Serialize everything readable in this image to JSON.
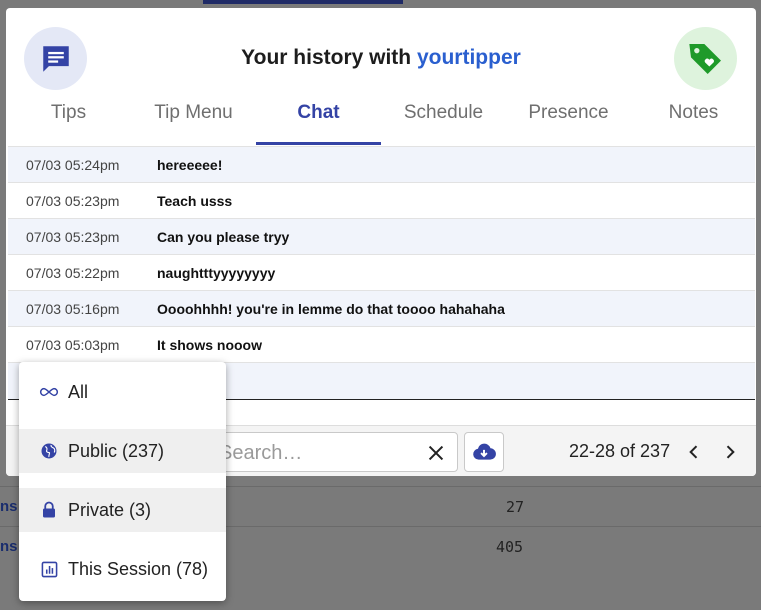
{
  "background": {
    "rows": [
      {
        "left": "ns",
        "value": "27"
      },
      {
        "left": "ns",
        "value": "405"
      }
    ]
  },
  "modal": {
    "title_prefix": "Your history with ",
    "username": "yourtipper",
    "tabs": [
      {
        "label": "Tips"
      },
      {
        "label": "Tip Menu"
      },
      {
        "label": "Chat",
        "active": true
      },
      {
        "label": "Schedule"
      },
      {
        "label": "Presence"
      },
      {
        "label": "Notes"
      }
    ],
    "messages": [
      {
        "time": "07/03 05:24pm",
        "text": "hereeeee!"
      },
      {
        "time": "07/03 05:23pm",
        "text": "Teach usss"
      },
      {
        "time": "07/03 05:23pm",
        "text": "Can you please tryy"
      },
      {
        "time": "07/03 05:22pm",
        "text": "naughtttyyyyyyyy"
      },
      {
        "time": "07/03 05:16pm",
        "text": "Oooohhhh! you're in lemme do that toooo hahahaha"
      },
      {
        "time": "07/03 05:03pm",
        "text": "It shows nooow"
      }
    ],
    "footer": {
      "search_placeholder": "Search…",
      "pagination": "22-28 of 237"
    }
  },
  "filter_menu": {
    "items": [
      {
        "icon": "infinity-icon",
        "label": "All"
      },
      {
        "icon": "globe-icon",
        "label": "Public (237)"
      },
      {
        "icon": "lock-icon",
        "label": "Private (3)"
      },
      {
        "icon": "bar-chart-icon",
        "label": "This Session (78)"
      }
    ]
  },
  "colors": {
    "accent": "#3443a5",
    "username": "#2a5fcf",
    "tag_green": "#1f9a2a"
  }
}
